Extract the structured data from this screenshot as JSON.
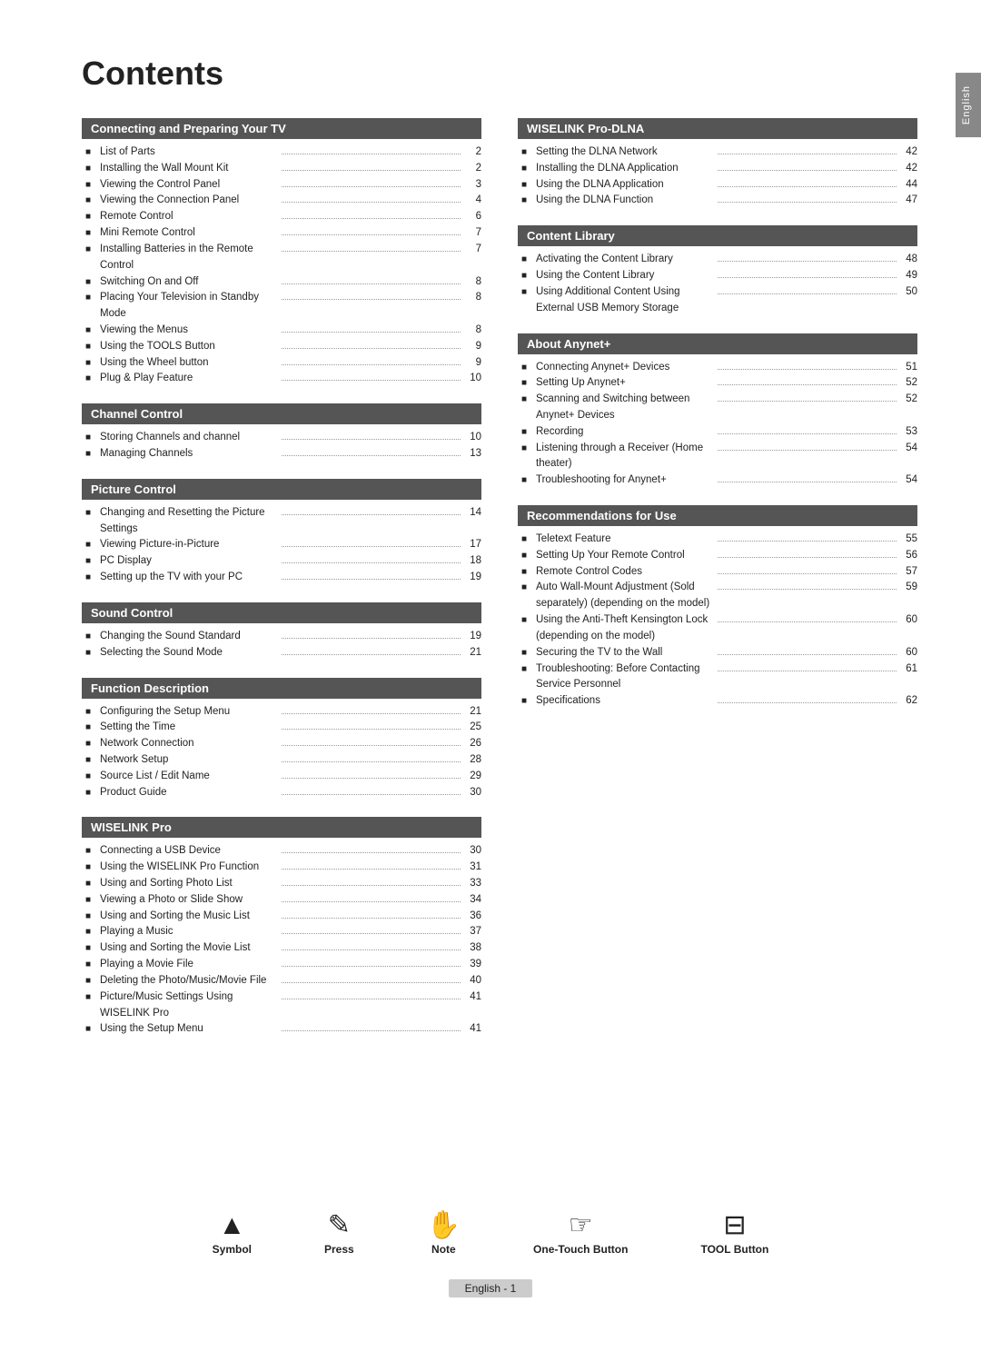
{
  "page": {
    "title": "Contents",
    "side_tab": "English",
    "footer": {
      "icons": [
        {
          "name": "Symbol",
          "icon": "▲",
          "label": "Symbol"
        },
        {
          "name": "Press",
          "icon": "✎",
          "label": "Press"
        },
        {
          "name": "Note",
          "icon": "☜",
          "label": "Note"
        },
        {
          "name": "One-Touch Button",
          "icon": "⊡",
          "label": "One-Touch Button"
        },
        {
          "name": "TOOL Button",
          "icon": "⊞",
          "label": "TOOL Button"
        }
      ],
      "page_label": "English - 1"
    }
  },
  "left_column": {
    "sections": [
      {
        "header": "Connecting and Preparing Your TV",
        "items": [
          {
            "text": "List of Parts",
            "page": "2"
          },
          {
            "text": "Installing the Wall Mount Kit",
            "page": "2"
          },
          {
            "text": "Viewing the Control Panel",
            "page": "3"
          },
          {
            "text": "Viewing the Connection Panel",
            "page": "4"
          },
          {
            "text": "Remote Control",
            "page": "6"
          },
          {
            "text": "Mini Remote Control",
            "page": "7"
          },
          {
            "text": "Installing Batteries in the Remote Control",
            "page": "7"
          },
          {
            "text": "Switching On and Off",
            "page": "8"
          },
          {
            "text": "Placing Your Television in Standby Mode",
            "page": "8"
          },
          {
            "text": "Viewing the Menus",
            "page": "8"
          },
          {
            "text": "Using the TOOLS Button",
            "page": "9"
          },
          {
            "text": "Using the Wheel button",
            "page": "9"
          },
          {
            "text": "Plug & Play Feature",
            "page": "10"
          }
        ]
      },
      {
        "header": "Channel Control",
        "items": [
          {
            "text": "Storing Channels and channel",
            "page": "10"
          },
          {
            "text": "Managing Channels",
            "page": "13"
          }
        ]
      },
      {
        "header": "Picture Control",
        "items": [
          {
            "text": "Changing and Resetting the Picture Settings",
            "page": "14"
          },
          {
            "text": "Viewing Picture-in-Picture",
            "page": "17"
          },
          {
            "text": "PC Display",
            "page": "18"
          },
          {
            "text": "Setting up the TV with your PC",
            "page": "19"
          }
        ]
      },
      {
        "header": "Sound Control",
        "items": [
          {
            "text": "Changing the Sound Standard",
            "page": "19"
          },
          {
            "text": "Selecting the Sound Mode",
            "page": "21"
          }
        ]
      },
      {
        "header": "Function Description",
        "items": [
          {
            "text": "Configuring the Setup Menu",
            "page": "21"
          },
          {
            "text": "Setting the Time",
            "page": "25"
          },
          {
            "text": "Network Connection",
            "page": "26"
          },
          {
            "text": "Network Setup",
            "page": "28"
          },
          {
            "text": "Source List / Edit Name",
            "page": "29"
          },
          {
            "text": "Product Guide",
            "page": "30"
          }
        ]
      },
      {
        "header": "WISELINK Pro",
        "items": [
          {
            "text": "Connecting a USB Device",
            "page": "30"
          },
          {
            "text": "Using the WISELINK Pro Function",
            "page": "31"
          },
          {
            "text": "Using and Sorting Photo List",
            "page": "33"
          },
          {
            "text": "Viewing a Photo or Slide Show",
            "page": "34"
          },
          {
            "text": "Using and Sorting the Music List",
            "page": "36"
          },
          {
            "text": "Playing a Music",
            "page": "37"
          },
          {
            "text": "Using and Sorting the Movie List",
            "page": "38"
          },
          {
            "text": "Playing a Movie File",
            "page": "39"
          },
          {
            "text": "Deleting the Photo/Music/Movie File",
            "page": "40"
          },
          {
            "text": "Picture/Music Settings Using WISELINK Pro",
            "page": "41"
          },
          {
            "text": "Using the Setup Menu",
            "page": "41"
          }
        ]
      }
    ]
  },
  "right_column": {
    "sections": [
      {
        "header": "WISELINK Pro-DLNA",
        "items": [
          {
            "text": "Setting the DLNA Network",
            "page": "42"
          },
          {
            "text": "Installing the DLNA Application",
            "page": "42"
          },
          {
            "text": "Using the DLNA Application",
            "page": "44"
          },
          {
            "text": "Using the DLNA Function",
            "page": "47"
          }
        ]
      },
      {
        "header": "Content Library",
        "items": [
          {
            "text": "Activating the Content Library",
            "page": "48"
          },
          {
            "text": "Using the Content Library",
            "page": "49"
          },
          {
            "text": "Using Additional Content Using External USB Memory Storage",
            "page": "50"
          }
        ]
      },
      {
        "header": "About Anynet+",
        "items": [
          {
            "text": "Connecting Anynet+ Devices",
            "page": "51"
          },
          {
            "text": "Setting Up Anynet+",
            "page": "52"
          },
          {
            "text": "Scanning and Switching between Anynet+ Devices",
            "page": "52"
          },
          {
            "text": "Recording",
            "page": "53"
          },
          {
            "text": "Listening through a Receiver (Home theater)",
            "page": "54"
          },
          {
            "text": "Troubleshooting for Anynet+",
            "page": "54"
          }
        ]
      },
      {
        "header": "Recommendations for Use",
        "items": [
          {
            "text": "Teletext Feature",
            "page": "55"
          },
          {
            "text": "Setting Up Your Remote Control",
            "page": "56"
          },
          {
            "text": "Remote Control Codes",
            "page": "57"
          },
          {
            "text": "Auto Wall-Mount Adjustment (Sold separately) (depending on the model)",
            "page": "59"
          },
          {
            "text": "Using the Anti-Theft Kensington Lock (depending on the model)",
            "page": "60"
          },
          {
            "text": "Securing the TV to the Wall",
            "page": "60"
          },
          {
            "text": "Troubleshooting: Before Contacting Service Personnel",
            "page": "61"
          },
          {
            "text": "Specifications",
            "page": "62"
          }
        ]
      }
    ]
  }
}
